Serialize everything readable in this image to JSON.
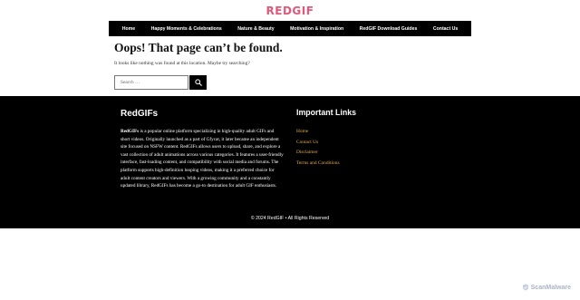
{
  "header": {
    "logo_text": "REDGIF"
  },
  "nav": {
    "items": [
      {
        "label": "Home"
      },
      {
        "label": "Happy Moments & Celebrations"
      },
      {
        "label": "Nature & Beauty"
      },
      {
        "label": "Motivation & Inspiration"
      },
      {
        "label": "RedGIF Download Guides"
      },
      {
        "label": "Contact Us"
      }
    ]
  },
  "main": {
    "title": "Oops! That page can’t be found.",
    "message": "It looks like nothing was found at this location. Maybe try searching?",
    "search": {
      "placeholder": "Search …",
      "button_icon": "search-icon"
    }
  },
  "footer": {
    "about_heading": "RedGIFs",
    "about_brand": "RedGIFs",
    "about_text": " is a popular online platform specializing in high-quality adult GIFs and short videos. Originally launched as a part of Gfycat, it later became an independent site focused on NSFW content. RedGIFs allows users to upload, share, and explore a vast collection of adult animations across various categories. It features a user-friendly interface, fast-loading content, and compatibility with social media and forums. The platform supports high-definition looping videos, making it a preferred choice for adult content creators and viewers. With a growing community and a constantly updated library, RedGIFs has become a go-to destination for adult GIF enthusiasts.",
    "links_heading": "Important Links",
    "links": [
      {
        "label": "Home"
      },
      {
        "label": "Contact Us"
      },
      {
        "label": "Disclaimer"
      },
      {
        "label": "Terms and Conditions"
      }
    ],
    "copyright": "© 2024 RedGIF • All Rights Reserved"
  },
  "watermark": {
    "text": "ScanMalware"
  },
  "colors": {
    "logo": "#e0587a",
    "nav_bg": "#000000",
    "footer_bg": "#000000",
    "footer_link": "#e4a94a"
  }
}
